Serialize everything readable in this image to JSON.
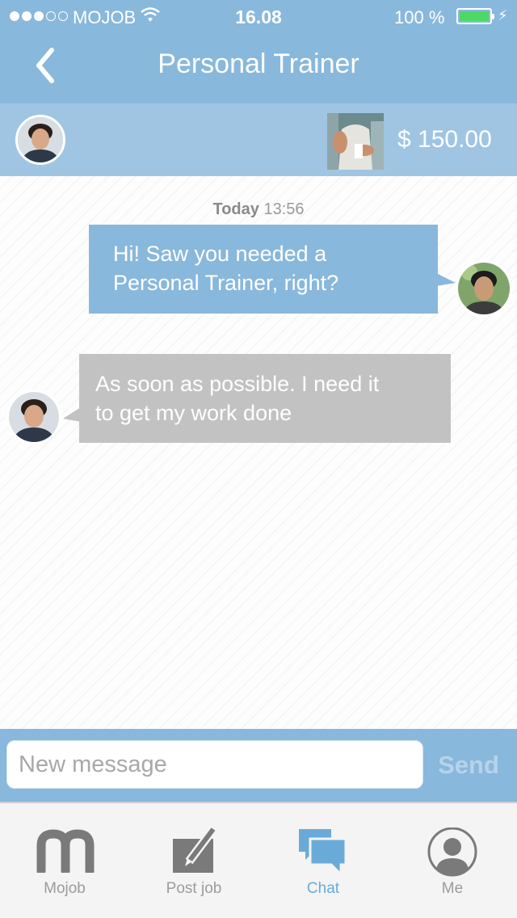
{
  "status_bar": {
    "carrier": "MOJOB",
    "time": "16.08",
    "battery": "100 %"
  },
  "nav": {
    "title": "Personal Trainer"
  },
  "job": {
    "price": "$ 150.00"
  },
  "chat": {
    "timestamp_day": "Today",
    "timestamp_time": "13:56",
    "messages": [
      {
        "from": "me",
        "text_line1": "Hi! Saw you needed a",
        "text_line2": "Personal Trainer, right?"
      },
      {
        "from": "them",
        "text_line1": "As soon as possible. I need it",
        "text_line2": "to get my work done"
      }
    ]
  },
  "composer": {
    "placeholder": "New message",
    "send_label": "Send"
  },
  "tabs": [
    {
      "label": "Mojob",
      "icon": "mojob-logo-icon",
      "active": false
    },
    {
      "label": "Post job",
      "icon": "edit-icon",
      "active": false
    },
    {
      "label": "Chat",
      "icon": "chat-icon",
      "active": true
    },
    {
      "label": "Me",
      "icon": "profile-icon",
      "active": false
    }
  ],
  "colors": {
    "header": "#88b8dc",
    "job_bar": "#9fc5e3",
    "outgoing_bubble": "#88b8dc",
    "incoming_bubble": "#c2c2c2",
    "active_tab": "#6aaad8",
    "battery_fill": "#4cd964"
  }
}
